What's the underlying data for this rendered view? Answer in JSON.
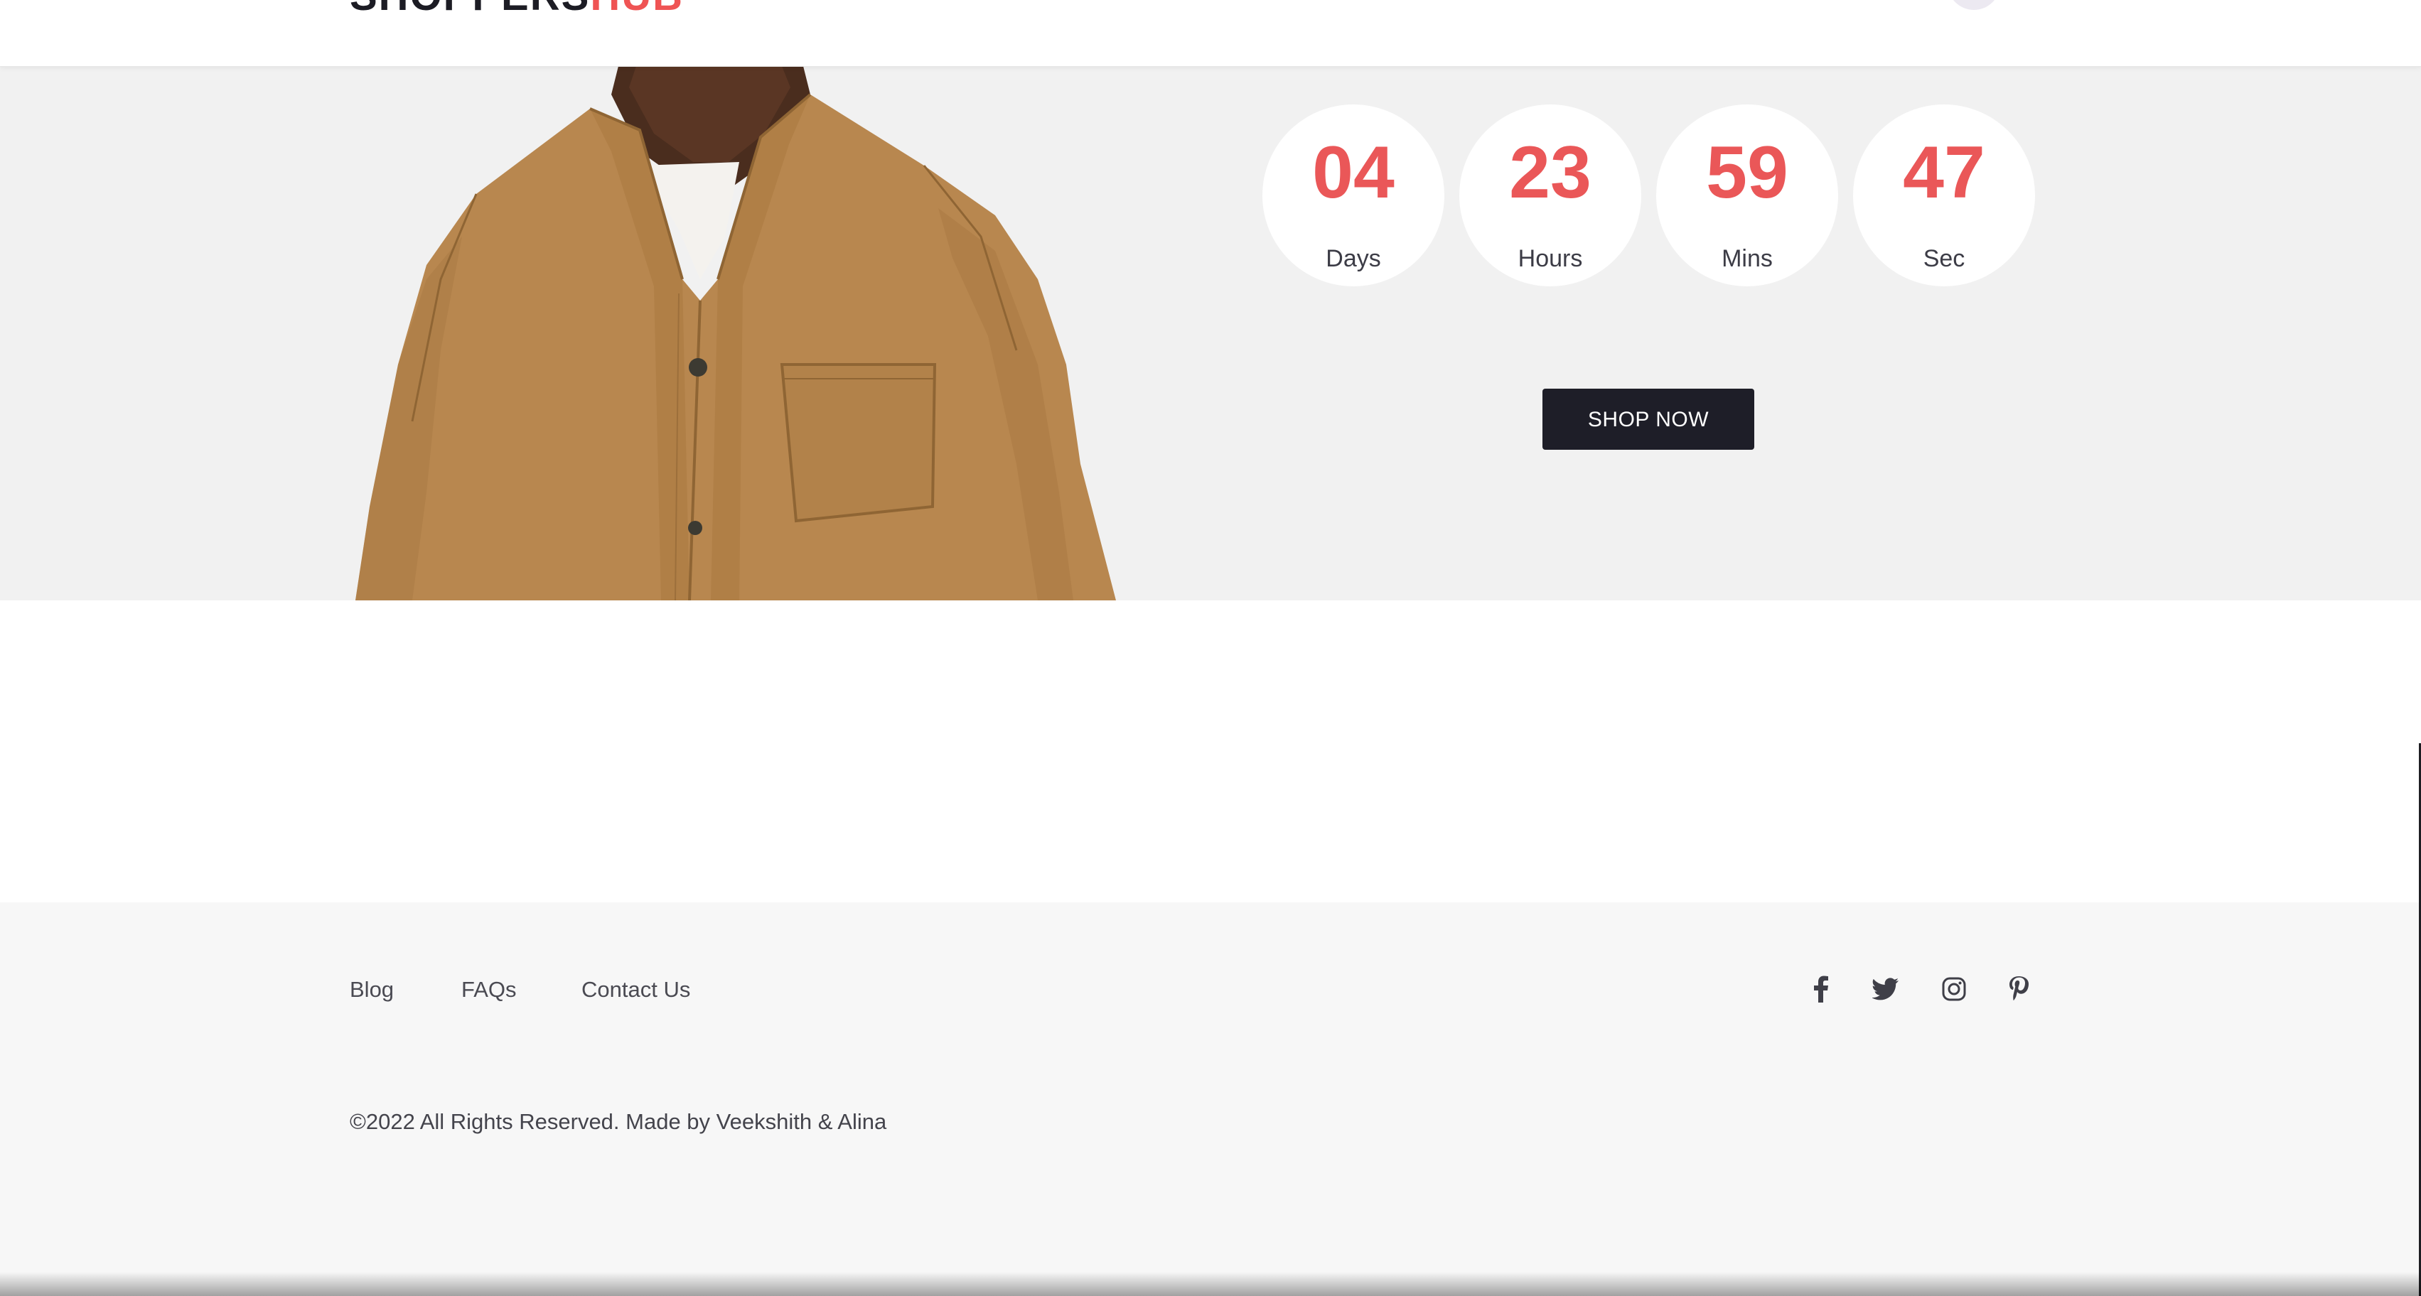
{
  "header": {
    "logo_main": "SHOPPERS",
    "logo_accent": "HUB"
  },
  "deal": {
    "countdown": [
      {
        "value": "04",
        "label": "Days"
      },
      {
        "value": "23",
        "label": "Hours"
      },
      {
        "value": "59",
        "label": "Mins"
      },
      {
        "value": "47",
        "label": "Sec"
      }
    ],
    "shop_button_label": "SHOP NOW"
  },
  "footer": {
    "links": [
      {
        "label": "Blog"
      },
      {
        "label": "FAQs"
      },
      {
        "label": "Contact Us"
      }
    ],
    "social_icons": [
      "facebook-icon",
      "twitter-icon",
      "instagram-icon",
      "pinterest-icon"
    ],
    "copyright": "©2022 All Rights Reserved. Made by Veekshith & Alina"
  },
  "colors": {
    "accent": "#ea5758",
    "dark": "#1e1e28",
    "deal_background": "#f1f1f1",
    "footer_background": "#f7f7f7"
  }
}
